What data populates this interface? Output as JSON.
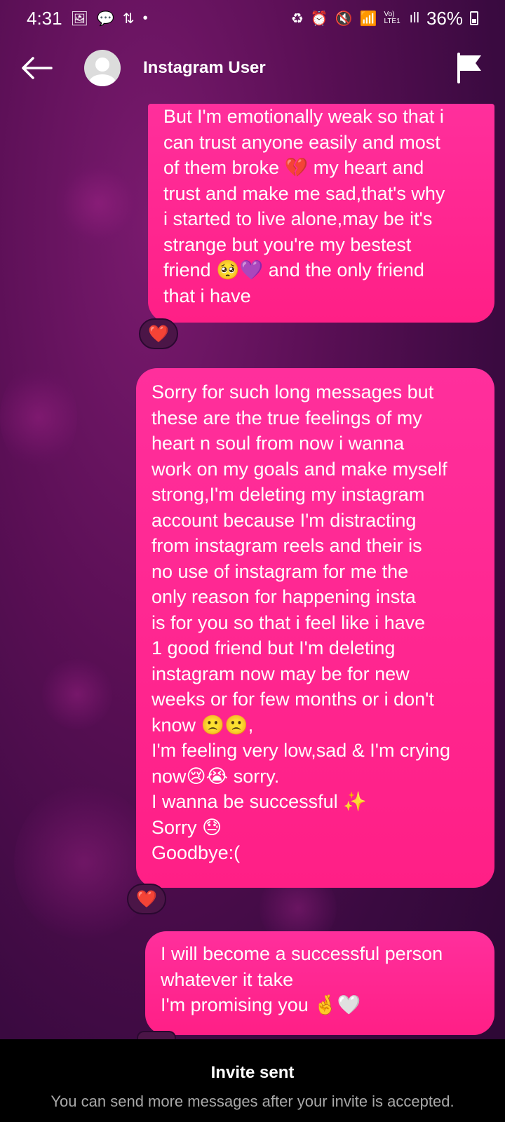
{
  "status_bar": {
    "time": "4:31",
    "battery": "36%",
    "left_icons": [
      "image-icon",
      "chat-bubble-icon",
      "data-transfer-icon",
      "dot-icon"
    ],
    "right_icons": [
      "battery-saver-icon",
      "alarm-icon",
      "mute-icon",
      "wifi-icon",
      "volte-icon",
      "signal-icon"
    ],
    "network_label": "Vo) LTE1"
  },
  "header": {
    "user_name": "Instagram User"
  },
  "messages": [
    {
      "text": "But I'm emotionally weak so that i\ncan trust anyone easily and most\nof them broke 💔 my heart and\ntrust and make me sad,that's why\ni started to live alone,may be it's\nstrange but you're my bestest\nfriend 🥺💜 and the only friend\nthat i have",
      "reaction": "❤️"
    },
    {
      "text": "Sorry for such long messages but\nthese are the true feelings of my\nheart n soul from now i wanna\nwork on my goals and make myself\nstrong,I'm deleting my instagram\naccount because I'm distracting\nfrom instagram reels and their is\nno use of instagram for me the\nonly reason for happening insta\nis for you so that i feel like i have\n1 good friend but I'm deleting\ninstagram now may be for new\nweeks or for few months or i don't\nknow 🙁🙁,\nI'm feeling very low,sad & I'm crying\nnow😢😭 sorry.\nI wanna be successful ✨\nSorry 😓\nGoodbye:(",
      "reaction": "❤️"
    },
    {
      "text": "I will become a successful person\nwhatever it take\nI'm promising you 🤞🤍"
    }
  ],
  "invite_banner": {
    "title": "Invite sent",
    "subtitle": "You can send more messages after your invite is accepted."
  }
}
